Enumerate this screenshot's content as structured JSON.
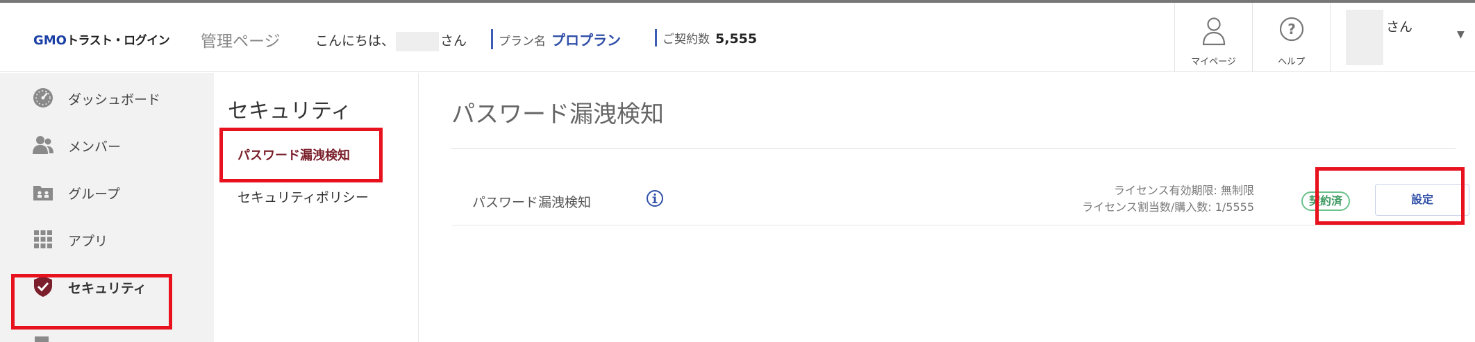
{
  "header": {
    "logo_prefix": "GMO",
    "logo_text": "トラスト・ログイン",
    "admin_label": "管理ページ",
    "greeting_prefix": "こんにちは、",
    "greeting_suffix": "さん",
    "plan_label": "プラン名",
    "plan_value": "プロプラン",
    "contract_label": "ご契約数",
    "contract_value": "5,555",
    "mypage_label": "マイページ",
    "help_label": "ヘルプ",
    "user_suffix": "さん",
    "caret": "▼"
  },
  "sidebar": {
    "items": [
      {
        "label": "ダッシュボード",
        "icon": "dashboard-icon"
      },
      {
        "label": "メンバー",
        "icon": "members-icon"
      },
      {
        "label": "グループ",
        "icon": "group-icon"
      },
      {
        "label": "アプリ",
        "icon": "apps-grid-icon"
      },
      {
        "label": "セキュリティ",
        "icon": "shield-check-icon",
        "active": true
      }
    ]
  },
  "subnav": {
    "title": "セキュリティ",
    "items": [
      "パスワード漏洩検知",
      "セキュリティポリシー"
    ]
  },
  "main": {
    "page_title": "パスワード漏洩検知",
    "row": {
      "name": "パスワード漏洩検知",
      "license_expiry": "ライセンス有効期限: 無制限",
      "license_count": "ライセンス割当数/購入数: 1/5555",
      "status_badge": "契約済",
      "settings_button": "設定"
    }
  },
  "colors": {
    "accent_blue": "#2f4fa7",
    "highlight_red": "#e8121f",
    "active_text": "#7a1f2b",
    "badge_green": "#3f9a63",
    "sidebar_bg": "#f2f2f2"
  }
}
